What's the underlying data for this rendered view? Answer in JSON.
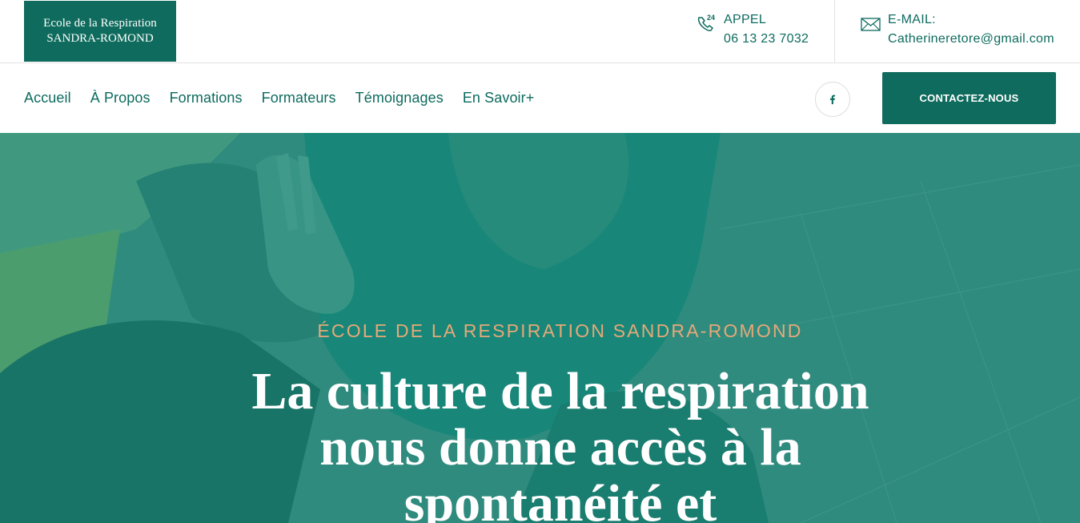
{
  "logo": {
    "line1": "Ecole de la Respiration",
    "line2": "SANDRA-ROMOND"
  },
  "header": {
    "phone": {
      "label": "APPEL",
      "value": "06 13 23 7032",
      "icon": "phone-24-icon"
    },
    "email": {
      "label": "E-MAIL:",
      "value": "Catherineretore@gmail.com",
      "icon": "envelope-icon"
    }
  },
  "nav": {
    "items": [
      {
        "label": "Accueil"
      },
      {
        "label": "À Propos"
      },
      {
        "label": "Formations"
      },
      {
        "label": "Formateurs"
      },
      {
        "label": "Témoignages"
      },
      {
        "label": "En Savoir+"
      }
    ],
    "social_icon": "facebook-icon",
    "cta_label": "CONTACTEZ-NOUS"
  },
  "hero": {
    "kicker": "ÉCOLE DE LA RESPIRATION SANDRA-ROMOND",
    "headline": "La culture de la respiration nous donne accès à la spontanéité et"
  },
  "colors": {
    "brand": "#0f6b5d",
    "accent": "#e7a878",
    "text": "#0d6b5f"
  }
}
